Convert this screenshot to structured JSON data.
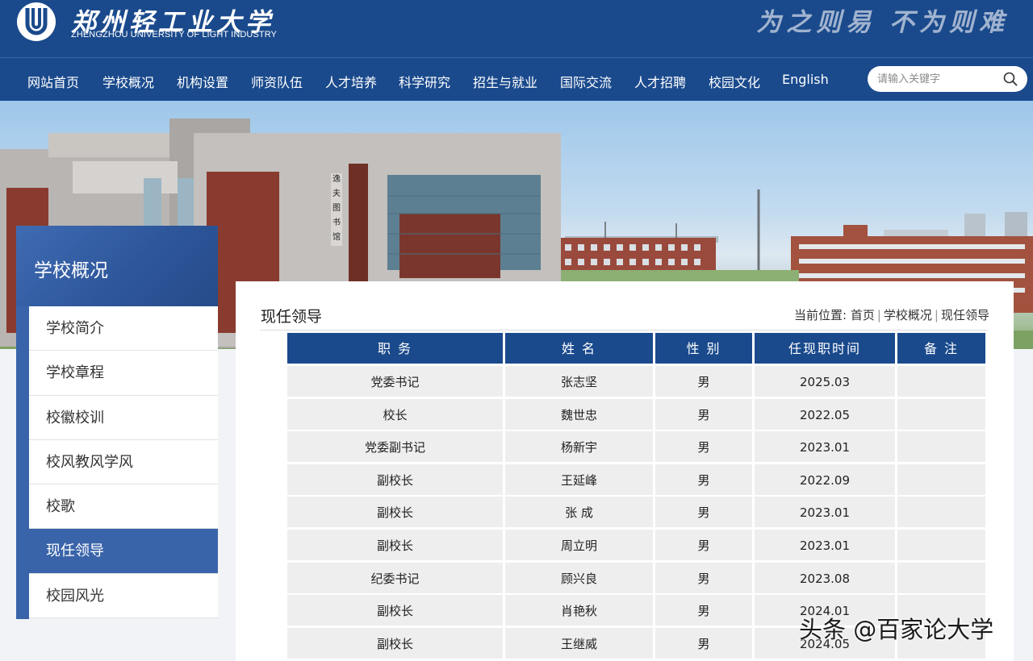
{
  "header": {
    "logo_cn": "郑州轻工业大学",
    "logo_en": "ZHENGZHOU UNIVERSITY OF LIGHT INDUSTRY",
    "motto": "为之则易 不为则难",
    "brand_color": "#1a4a8c"
  },
  "nav": {
    "items": [
      "网站首页",
      "学校概况",
      "机构设置",
      "师资队伍",
      "人才培养",
      "科学研究",
      "招生与就业",
      "国际交流",
      "人才招聘",
      "校园文化",
      "English"
    ],
    "search_placeholder": "请输入关键字",
    "search_icon": "search-icon"
  },
  "sidebar": {
    "title": "学校概况",
    "items": [
      {
        "label": "学校简介",
        "active": false
      },
      {
        "label": "学校章程",
        "active": false
      },
      {
        "label": "校徽校训",
        "active": false
      },
      {
        "label": "校风教风学风",
        "active": false
      },
      {
        "label": "校歌",
        "active": false
      },
      {
        "label": "现任领导",
        "active": true
      },
      {
        "label": "校园风光",
        "active": false
      }
    ]
  },
  "main": {
    "title": "现任领导",
    "breadcrumb": {
      "prefix": "当前位置:",
      "items": [
        "首页",
        "学校概况",
        "现任领导"
      ],
      "separator": "|"
    },
    "table": {
      "headers": [
        "职 务",
        "姓 名",
        "性 别",
        "任现职时间",
        "备 注"
      ],
      "rows": [
        [
          "党委书记",
          "张志坚",
          "男",
          "2025.03",
          ""
        ],
        [
          "校长",
          "魏世忠",
          "男",
          "2022.05",
          ""
        ],
        [
          "党委副书记",
          "杨新宇",
          "男",
          "2023.01",
          ""
        ],
        [
          "副校长",
          "王延峰",
          "男",
          "2022.09",
          ""
        ],
        [
          "副校长",
          "张 成",
          "男",
          "2023.01",
          ""
        ],
        [
          "副校长",
          "周立明",
          "男",
          "2023.01",
          ""
        ],
        [
          "纪委书记",
          "顾兴良",
          "男",
          "2023.08",
          ""
        ],
        [
          "副校长",
          "肖艳秋",
          "男",
          "2024.01",
          ""
        ],
        [
          "副校长",
          "王继威",
          "男",
          "2024.05",
          ""
        ]
      ]
    }
  },
  "watermark": "头条 @百家论大学"
}
